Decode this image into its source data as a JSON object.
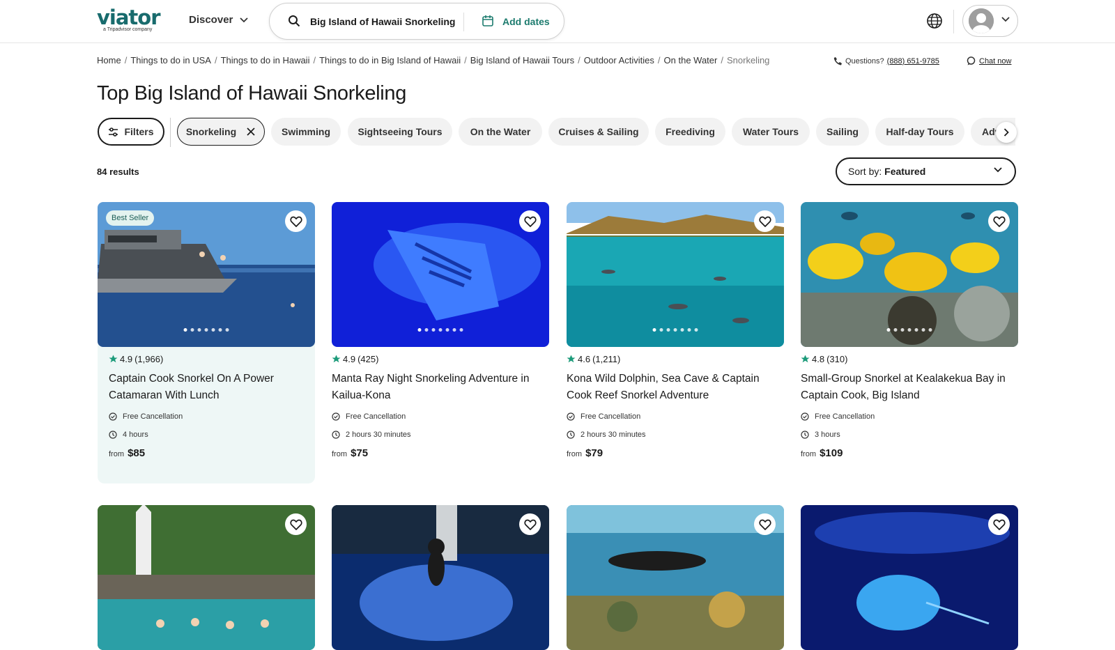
{
  "header": {
    "logo": "viator",
    "logo_sub": "a Tripadvisor company",
    "discover": "Discover",
    "search_value": "Big Island of Hawaii Snorkeling",
    "dates_label": "Add dates"
  },
  "breadcrumbs": [
    "Home",
    "Things to do in USA",
    "Things to do in Hawaii",
    "Things to do in Big Island of Hawaii",
    "Big Island of Hawaii Tours",
    "Outdoor Activities",
    "On the Water",
    "Snorkeling"
  ],
  "help": {
    "questions": "Questions?",
    "phone": "(888) 651-9785",
    "chat": "Chat now"
  },
  "page_title": "Top Big Island of Hawaii Snorkeling",
  "filters": {
    "filters_label": "Filters",
    "chips": [
      "Snorkeling",
      "Swimming",
      "Sightseeing Tours",
      "On the Water",
      "Cruises & Sailing",
      "Freediving",
      "Water Tours",
      "Sailing",
      "Half-day Tours",
      "Adv"
    ]
  },
  "results_count": "84 results",
  "sort": {
    "prefix": "Sort by:",
    "value": "Featured"
  },
  "cards": [
    {
      "badge": "Best Seller",
      "rating": "4.9",
      "reviews": "(1,966)",
      "title": "Captain Cook Snorkel On A Power Catamaran With Lunch",
      "cancel": "Free Cancellation",
      "duration": "4 hours",
      "from": "from",
      "price": "$85"
    },
    {
      "rating": "4.9",
      "reviews": "(425)",
      "title": "Manta Ray Night Snorkeling Adventure in Kailua-Kona",
      "cancel": "Free Cancellation",
      "duration": "2 hours 30 minutes",
      "from": "from",
      "price": "$75"
    },
    {
      "rating": "4.6",
      "reviews": "(1,211)",
      "title": "Kona Wild Dolphin, Sea Cave & Captain Cook Reef Snorkel Adventure",
      "cancel": "Free Cancellation",
      "duration": "2 hours 30 minutes",
      "from": "from",
      "price": "$79"
    },
    {
      "rating": "4.8",
      "reviews": "(310)",
      "title": "Small-Group Snorkel at Kealakekua Bay in Captain Cook, Big Island",
      "cancel": "Free Cancellation",
      "duration": "3 hours",
      "from": "from",
      "price": "$109"
    }
  ],
  "colors": {
    "brand": "#186b6d",
    "accent": "#1c7b6e",
    "star": "#1c9b7a",
    "highlight_bg": "#eef7f6"
  },
  "icons": [
    "search-icon",
    "calendar-icon",
    "globe-icon",
    "chevron-down-icon",
    "phone-icon",
    "chat-icon",
    "filter-icon",
    "close-icon",
    "chevron-right-icon",
    "heart-icon",
    "star-icon",
    "check-circle-icon",
    "clock-icon"
  ]
}
